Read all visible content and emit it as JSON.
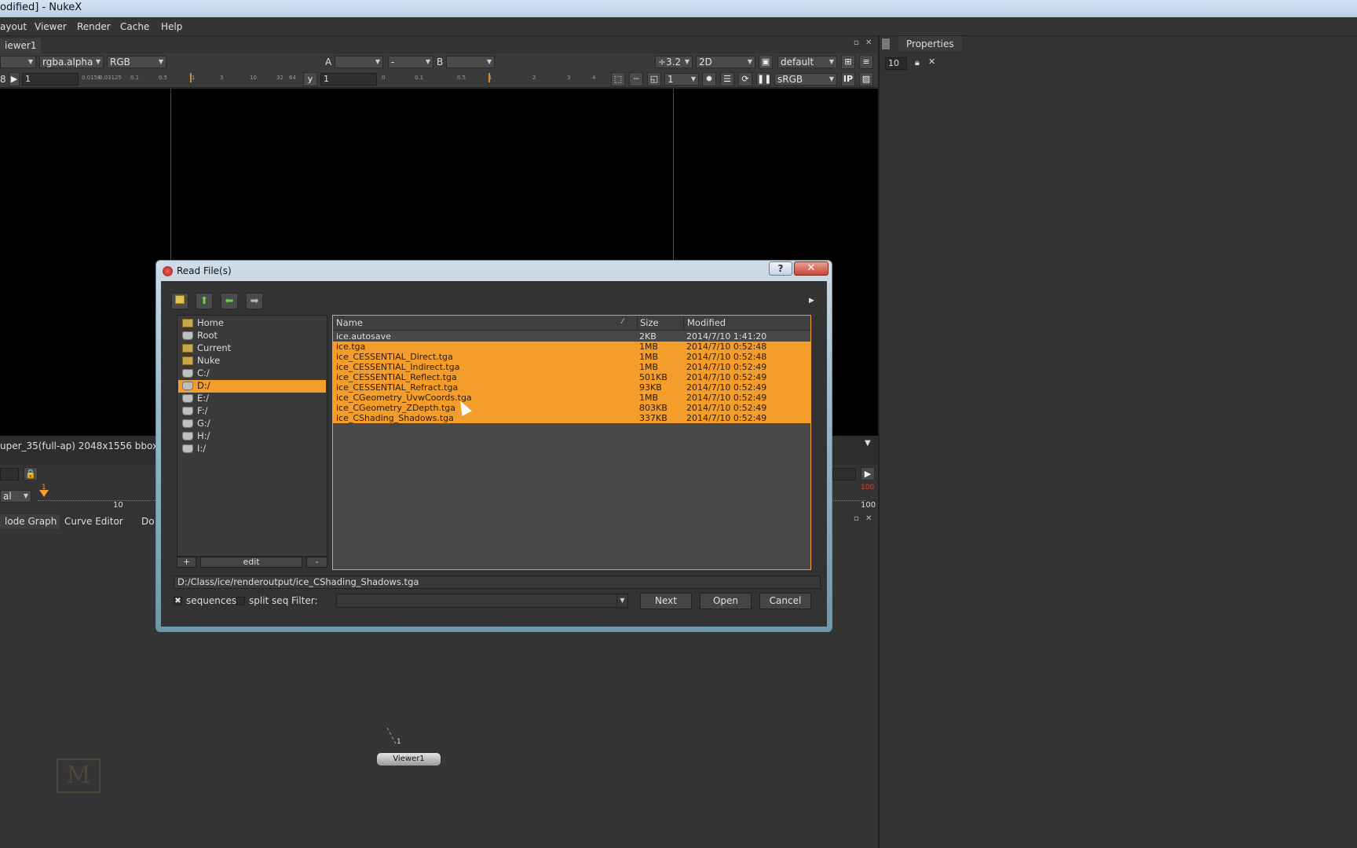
{
  "window": {
    "title": "odified] - NukeX"
  },
  "menus": [
    "ayout",
    "Viewer",
    "Render",
    "Cache",
    "Help"
  ],
  "viewer": {
    "tab": "iewer1",
    "toolbar1": {
      "channel_left": "",
      "channel_alpha": "rgba.alpha",
      "display": "RGB",
      "a_label": "A",
      "a_input": "",
      "dash": "-",
      "b_label": "B",
      "b_input": "",
      "zoom": "÷3.2",
      "view_mode": "2D",
      "lut_default": "default"
    },
    "toolbar2": {
      "gain_label": "8",
      "gain_value": "1",
      "gain_ticks": [
        "0.0156",
        "0.03125",
        "0.1",
        "0.5",
        "1",
        "3",
        "10",
        "32",
        "64"
      ],
      "gamma_label": "y",
      "gamma_value": "1",
      "gamma_ticks": [
        "0",
        "0.1",
        "0.5",
        "1",
        "2",
        "3",
        "4"
      ],
      "proxy": "1",
      "colorspace": "sRGB",
      "ip": "IP"
    },
    "info_text": "uper_35(full-ap) 2048x1556 bbox:",
    "timeline": {
      "mode": "al",
      "start": "1",
      "mark10": "10",
      "end_marker": "100",
      "end": "100"
    }
  },
  "nodegraph": {
    "tabs": [
      "lode Graph",
      "Curve Editor",
      "Do"
    ],
    "viewer_node": "Viewer1",
    "input_number": "1",
    "watermark": "M"
  },
  "properties": {
    "tab": "Properties",
    "max_panels": "10"
  },
  "dialog": {
    "title": "Read File(s)",
    "help_btn": "?",
    "close_btn": "✕",
    "places": [
      {
        "label": "Home",
        "icon": "home-folder-icon"
      },
      {
        "label": "Root",
        "icon": "drive-icon"
      },
      {
        "label": "Current",
        "icon": "folder-icon"
      },
      {
        "label": "Nuke",
        "icon": "folder-icon"
      },
      {
        "label": "C:/",
        "icon": "drive-icon"
      },
      {
        "label": "D:/",
        "icon": "drive-icon"
      },
      {
        "label": "E:/",
        "icon": "drive-icon"
      },
      {
        "label": "F:/",
        "icon": "drive-icon"
      },
      {
        "label": "G:/",
        "icon": "drive-icon"
      },
      {
        "label": "H:/",
        "icon": "drive-icon"
      },
      {
        "label": "I:/",
        "icon": "drive-icon"
      }
    ],
    "selected_place": "D:/",
    "places_buttons": {
      "add": "+",
      "edit": "edit",
      "remove": "-"
    },
    "columns": {
      "name": "Name",
      "size": "Size",
      "modified": "Modified"
    },
    "files": [
      {
        "name": "ice.autosave",
        "size": "2KB",
        "modified": "2014/7/10 1:41:20",
        "selected": false
      },
      {
        "name": "ice.tga",
        "size": "1MB",
        "modified": "2014/7/10 0:52:48",
        "selected": true
      },
      {
        "name": "ice_CESSENTIAL_Direct.tga",
        "size": "1MB",
        "modified": "2014/7/10 0:52:48",
        "selected": true
      },
      {
        "name": "ice_CESSENTIAL_Indirect.tga",
        "size": "1MB",
        "modified": "2014/7/10 0:52:49",
        "selected": true
      },
      {
        "name": "ice_CESSENTIAL_Reflect.tga",
        "size": "501KB",
        "modified": "2014/7/10 0:52:49",
        "selected": true
      },
      {
        "name": "ice_CESSENTIAL_Refract.tga",
        "size": "93KB",
        "modified": "2014/7/10 0:52:49",
        "selected": true
      },
      {
        "name": "ice_CGeometry_UvwCoords.tga",
        "size": "1MB",
        "modified": "2014/7/10 0:52:49",
        "selected": true
      },
      {
        "name": "ice_CGeometry_ZDepth.tga",
        "size": "803KB",
        "modified": "2014/7/10 0:52:49",
        "selected": true
      },
      {
        "name": "ice_CShading_Shadows.tga",
        "size": "337KB",
        "modified": "2014/7/10 0:52:49",
        "selected": true
      }
    ],
    "path": "D:/Class/ice/renderoutput/ice_CShading_Shadows.tga",
    "sequences_label": "sequences",
    "sequences_checked": true,
    "split_seq_label": "split seq",
    "split_seq_checked": false,
    "filter_label": "Filter:",
    "filter_value": "",
    "next_label": "Next",
    "open_label": "Open",
    "cancel_label": "Cancel"
  },
  "colors": {
    "accent": "#f59d2a",
    "panel_bg": "#333333",
    "viewer_bg": "#000000"
  }
}
